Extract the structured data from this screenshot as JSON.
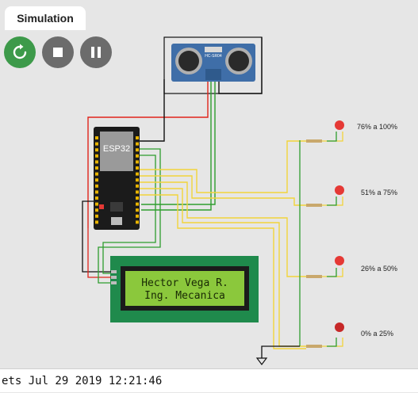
{
  "tab": {
    "label": "Simulation"
  },
  "controls": {
    "restart_icon": "restart-icon",
    "stop_icon": "stop-icon",
    "pause_icon": "pause-icon"
  },
  "sensor": {
    "label": "HC-SR04"
  },
  "board": {
    "label": "ESP32"
  },
  "lcd": {
    "line1": "Hector Vega R.",
    "line2": "Ing. Mecanica"
  },
  "leds": [
    {
      "label": "76% a 100%"
    },
    {
      "label": "51% a 75%"
    },
    {
      "label": "26% a 50%"
    },
    {
      "label": "0% a 25%"
    }
  ],
  "console": {
    "text": "ets Jul 29 2019 12:21:46"
  },
  "colors": {
    "wire_red": "#e0241b",
    "wire_green": "#2e9d2e",
    "wire_yellow": "#f2d43a",
    "wire_black": "#111111",
    "led_red": "#e53935",
    "lcd_bg": "#8bc83c",
    "lcd_frame": "#1f8a4c"
  }
}
